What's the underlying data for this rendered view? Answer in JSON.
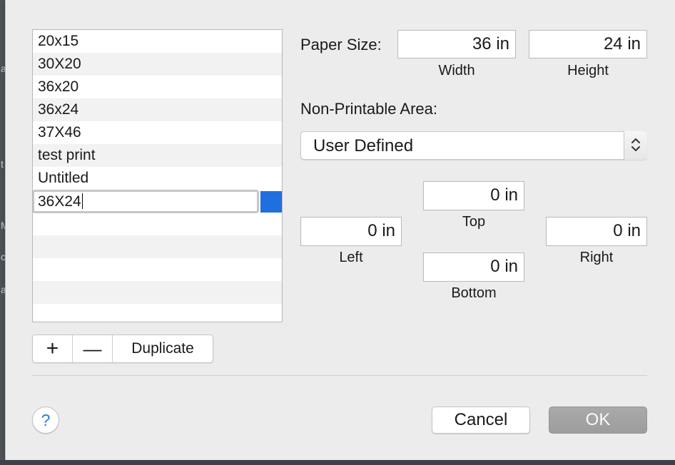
{
  "background_letters": [
    "a",
    "t",
    "M",
    "c",
    "a"
  ],
  "paper_list": {
    "items": [
      "20x15",
      "30X20",
      "36x20",
      "36x24",
      "37X46",
      "test print",
      "Untitled"
    ],
    "editing_value": "36X24"
  },
  "list_controls": {
    "add_label": "+",
    "remove_label": "—",
    "duplicate_label": "Duplicate"
  },
  "paper_size": {
    "label": "Paper Size:",
    "width_value": "36 in",
    "width_caption": "Width",
    "height_value": "24 in",
    "height_caption": "Height"
  },
  "non_printable": {
    "label": "Non-Printable Area:",
    "selected": "User Defined",
    "top_value": "0 in",
    "top_caption": "Top",
    "left_value": "0 in",
    "left_caption": "Left",
    "right_value": "0 in",
    "right_caption": "Right",
    "bottom_value": "0 in",
    "bottom_caption": "Bottom"
  },
  "footer": {
    "help_label": "?",
    "cancel_label": "Cancel",
    "ok_label": "OK"
  },
  "colors": {
    "selection_blue": "#1f6fde",
    "help_blue": "#2a7ae2",
    "dialog_bg": "#ececec"
  }
}
